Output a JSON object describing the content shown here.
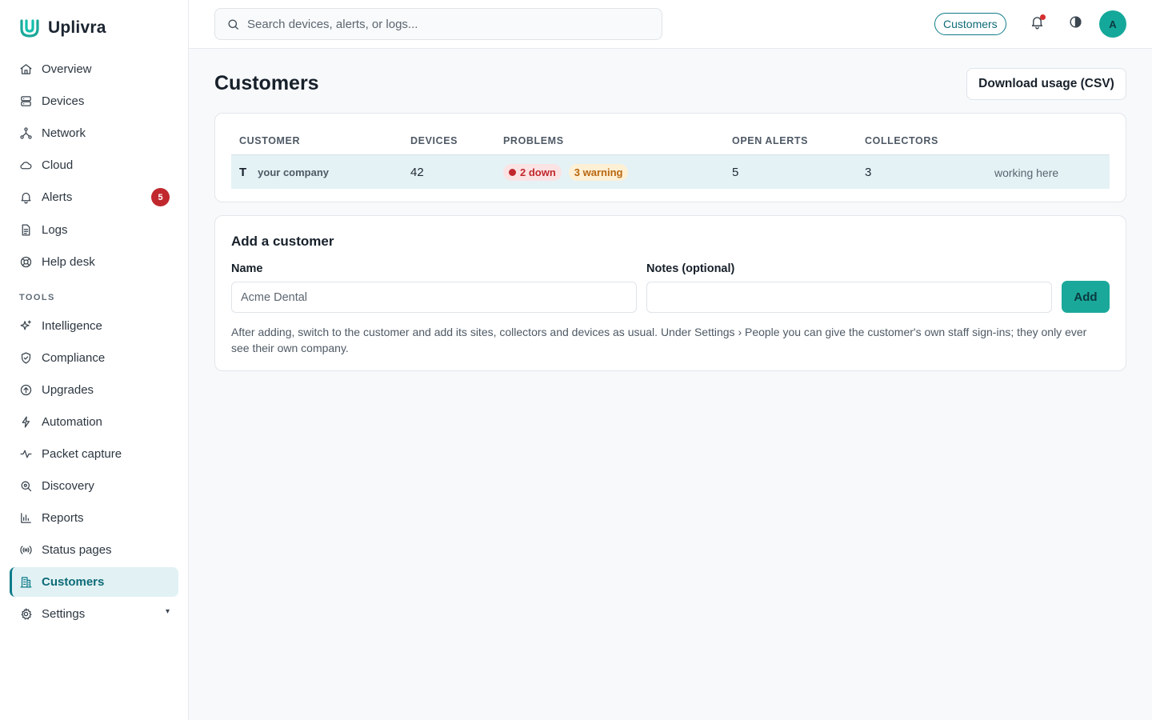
{
  "brand": {
    "name": "Uplivra",
    "accent": "#1aa89a"
  },
  "sidebar": {
    "items": [
      {
        "label": "Overview",
        "icon": "home-icon"
      },
      {
        "label": "Devices",
        "icon": "server-icon"
      },
      {
        "label": "Network",
        "icon": "network-icon"
      },
      {
        "label": "Cloud",
        "icon": "cloud-icon"
      },
      {
        "label": "Alerts",
        "icon": "bell-icon",
        "badge": "5"
      },
      {
        "label": "Logs",
        "icon": "file-text-icon"
      },
      {
        "label": "Help desk",
        "icon": "lifebuoy-icon"
      }
    ],
    "tools_label": "TOOLS",
    "tools": [
      {
        "label": "Intelligence",
        "icon": "sparkles-icon"
      },
      {
        "label": "Compliance",
        "icon": "shield-check-icon"
      },
      {
        "label": "Upgrades",
        "icon": "arrow-up-circle-icon"
      },
      {
        "label": "Automation",
        "icon": "bolt-icon"
      },
      {
        "label": "Packet capture",
        "icon": "activity-icon"
      },
      {
        "label": "Discovery",
        "icon": "search-zoom-icon"
      },
      {
        "label": "Reports",
        "icon": "bar-chart-icon"
      },
      {
        "label": "Status pages",
        "icon": "broadcast-icon"
      },
      {
        "label": "Customers",
        "icon": "building-icon",
        "active": true
      },
      {
        "label": "Settings",
        "icon": "gear-icon",
        "caret": "▾"
      }
    ]
  },
  "topbar": {
    "search_placeholder": "Search devices, alerts, or logs...",
    "context_chip": "Customers",
    "avatar_initial": "A",
    "notification_dot_color": "#d62d2d"
  },
  "main": {
    "title": "Customers",
    "download_button": "Download usage (CSV)",
    "table": {
      "columns": [
        "CUSTOMER",
        "DEVICES",
        "PROBLEMS",
        "OPEN ALERTS",
        "COLLECTORS"
      ],
      "rows": [
        {
          "initial": "T",
          "name": "your company",
          "devices": "42",
          "down": "2 down",
          "warning": "3 warning",
          "open_alerts": "5",
          "collectors": "3",
          "status": "working here"
        }
      ]
    },
    "add_customer": {
      "title": "Add a customer",
      "name_label": "Name",
      "name_placeholder": "Acme Dental",
      "notes_label": "Notes (optional)",
      "notes_placeholder": "",
      "add_button": "Add",
      "help_text": "After adding, switch to the customer and add its sites, collectors and devices as usual. Under Settings › People you can give the customer's own staff sign-ins; they only ever see their own company."
    }
  }
}
